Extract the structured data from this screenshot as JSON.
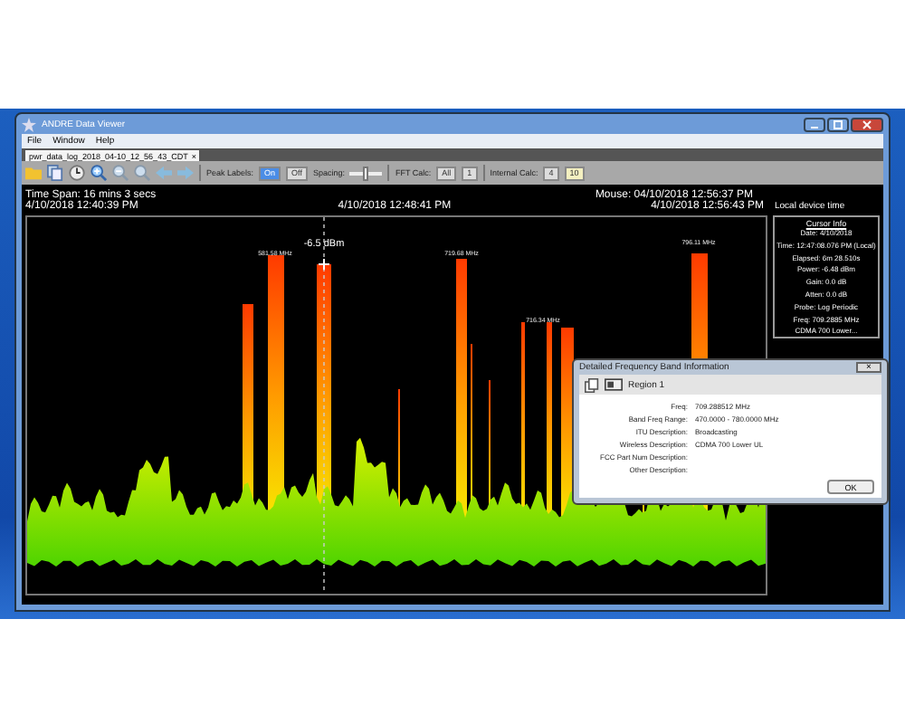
{
  "window": {
    "title": "ANDRE Data Viewer"
  },
  "menu": [
    "File",
    "Window",
    "Help"
  ],
  "tabs": [
    {
      "label": "pwr_data_log_2018_04-10_12_56_43_CDT",
      "close": "×",
      "selected": true
    }
  ],
  "toolbar": {
    "peak_labels": {
      "label": "Peak Labels:",
      "options": [
        {
          "label": "On",
          "selected": true
        },
        {
          "label": "Off",
          "selected": false
        }
      ]
    },
    "spacing": {
      "label": "Spacing:",
      "level": 0.5
    },
    "fft_calc": {
      "label": "FFT Calc:",
      "options": [
        {
          "label": "All",
          "selected": false
        },
        {
          "label": "1",
          "selected": false
        }
      ]
    },
    "internal_calc": {
      "label": "Internal Calc:",
      "options": [
        {
          "label": "4",
          "selected": false
        },
        {
          "label": "10",
          "selected": true
        }
      ]
    }
  },
  "time_span": "Time Span: 16 mins 3 secs",
  "mouse": "Mouse: 04/10/2018 12:56:37 PM",
  "timestamps": [
    "4/10/2018 12:40:39 PM",
    "4/10/2018 12:48:41 PM",
    "4/10/2018 12:56:43 PM"
  ],
  "time_note": "Local device time",
  "peak_markers": [
    {
      "kind": "freq",
      "text": "581.58 MHz"
    },
    {
      "kind": "power",
      "text": "-6.5 dBm"
    },
    {
      "kind": "freq",
      "text": "719.68 MHz"
    },
    {
      "kind": "freq",
      "text": "716.34 MHz"
    },
    {
      "kind": "freq",
      "text": "796.11 MHz"
    }
  ],
  "cursor_info": {
    "title": "Cursor Info",
    "lines": [
      "Date: 4/10/2018",
      "Time: 12:47:08.076 PM (Local)",
      "Elapsed: 6m 28.510s",
      "Power: -6.48 dBm",
      "Gain: 0.0 dB",
      "Atten: 0.0 dB",
      "Probe: Log Periodic",
      "Freq: 709.2885 MHz",
      "CDMA 700 Lower..."
    ]
  },
  "dialog": {
    "title": "Detailed Frequency Band Information",
    "close": "×",
    "region": "Region 1",
    "fields": [
      {
        "label": "Freq:",
        "value": "709.288512 MHz"
      },
      {
        "label": "Band Freq Range:",
        "value": "470.0000 - 780.0000 MHz"
      },
      {
        "label": "ITU Description:",
        "value": "Broadcasting"
      },
      {
        "label": "Wireless Description:",
        "value": "CDMA 700 Lower UL"
      },
      {
        "label": "FCC Part Num Description:"
      },
      {
        "label": "Other Description:"
      }
    ],
    "button": "OK"
  }
}
